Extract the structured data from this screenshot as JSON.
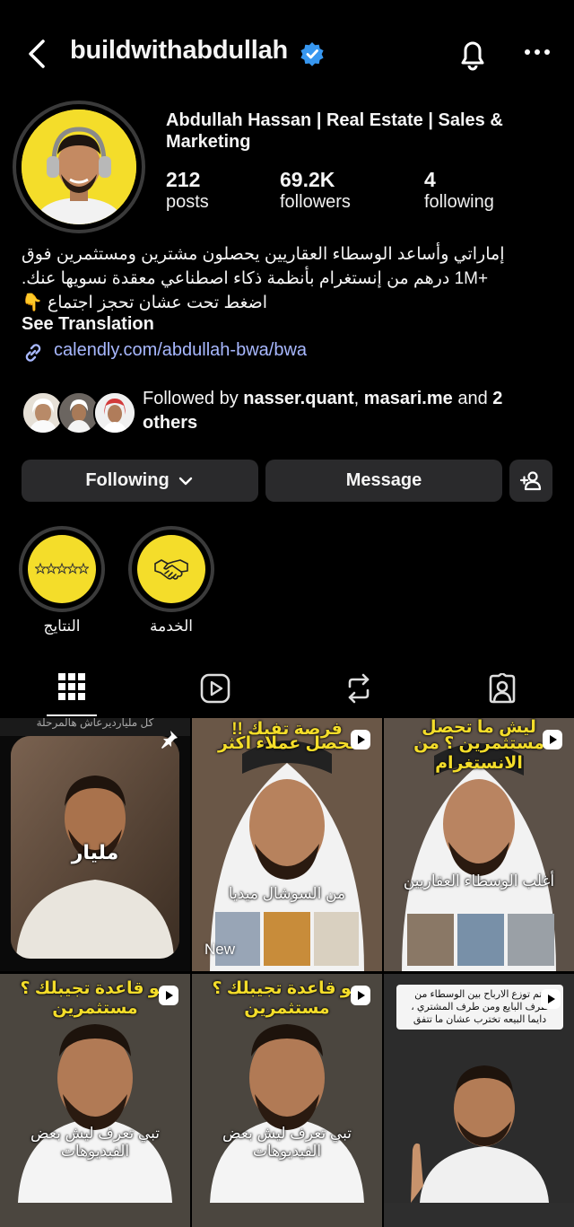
{
  "header": {
    "username": "buildwithabdullah"
  },
  "profile": {
    "full_name": "Abdullah Hassan | Real Estate | Sales & Marketing",
    "stats": [
      {
        "value": "212",
        "label": "posts"
      },
      {
        "value": "69.2K",
        "label": "followers"
      },
      {
        "value": "4",
        "label": "following"
      }
    ],
    "bio_line1": "إماراتي وأساعد الوسطاء العقاريين يحصلون مشترين ومستثمرين فوق",
    "bio_line2": "+1M درهم من إنستغرام بأنظمة ذكاء اصطناعي معقدة نسويها عنك.",
    "bio_line3": "اضغط تحت عشان تحجز اجتماع 👇",
    "see_translation": "See Translation",
    "link": "calendly.com/abdullah-bwa/bwa",
    "followed_by_prefix": "Followed by ",
    "followed_by_user1": "nasser.quant",
    "followed_by_sep": ", ",
    "followed_by_user2": "masari.me",
    "followed_by_and": " and ",
    "followed_by_others": "2 others"
  },
  "actions": {
    "following": "Following",
    "message": "Message"
  },
  "highlights": [
    {
      "label": "النتايج",
      "icon": "stars-icon"
    },
    {
      "label": "الخدمة",
      "icon": "handshake-icon"
    }
  ],
  "tabs": [
    "grid-icon",
    "reels-icon",
    "reposts-icon",
    "tagged-icon"
  ],
  "grid": [
    {
      "top_text": "كل مليارديرعاش هالمرحلة",
      "overlay": "مليار",
      "pinned": true
    },
    {
      "top_text": "فرصة تفيك !!",
      "caption": "تحصل عملاء اكثر",
      "sub": "من السوشال ميديا",
      "badge": "New"
    },
    {
      "top_text": "ليش ما تحصل",
      "caption": "مستثمرين ؟ من الانستغرام",
      "sub": "أغلب الوسطاء العقاريين"
    },
    {
      "caption": "مو قاعدة تجيبلك ؟ مستثمرين",
      "sub": "تبي تعرف ليش بعض الفيديوهات"
    },
    {
      "caption": "مو قاعدة تجيبلك ؟ مستثمرين",
      "sub": "تبي تعرف ليش بعض الفيديوهات"
    },
    {
      "comment": "يتم توزع الارباح بين الوسطاء من طرف البايع ومن طرف المشتري ، دايما البيعه تخترب عشان ما تتفق"
    }
  ],
  "colors": {
    "accent_yellow": "#f4dd2a",
    "button_bg": "#2a2a2c",
    "link": "#a8b8ff",
    "verified": "#3797f0"
  }
}
